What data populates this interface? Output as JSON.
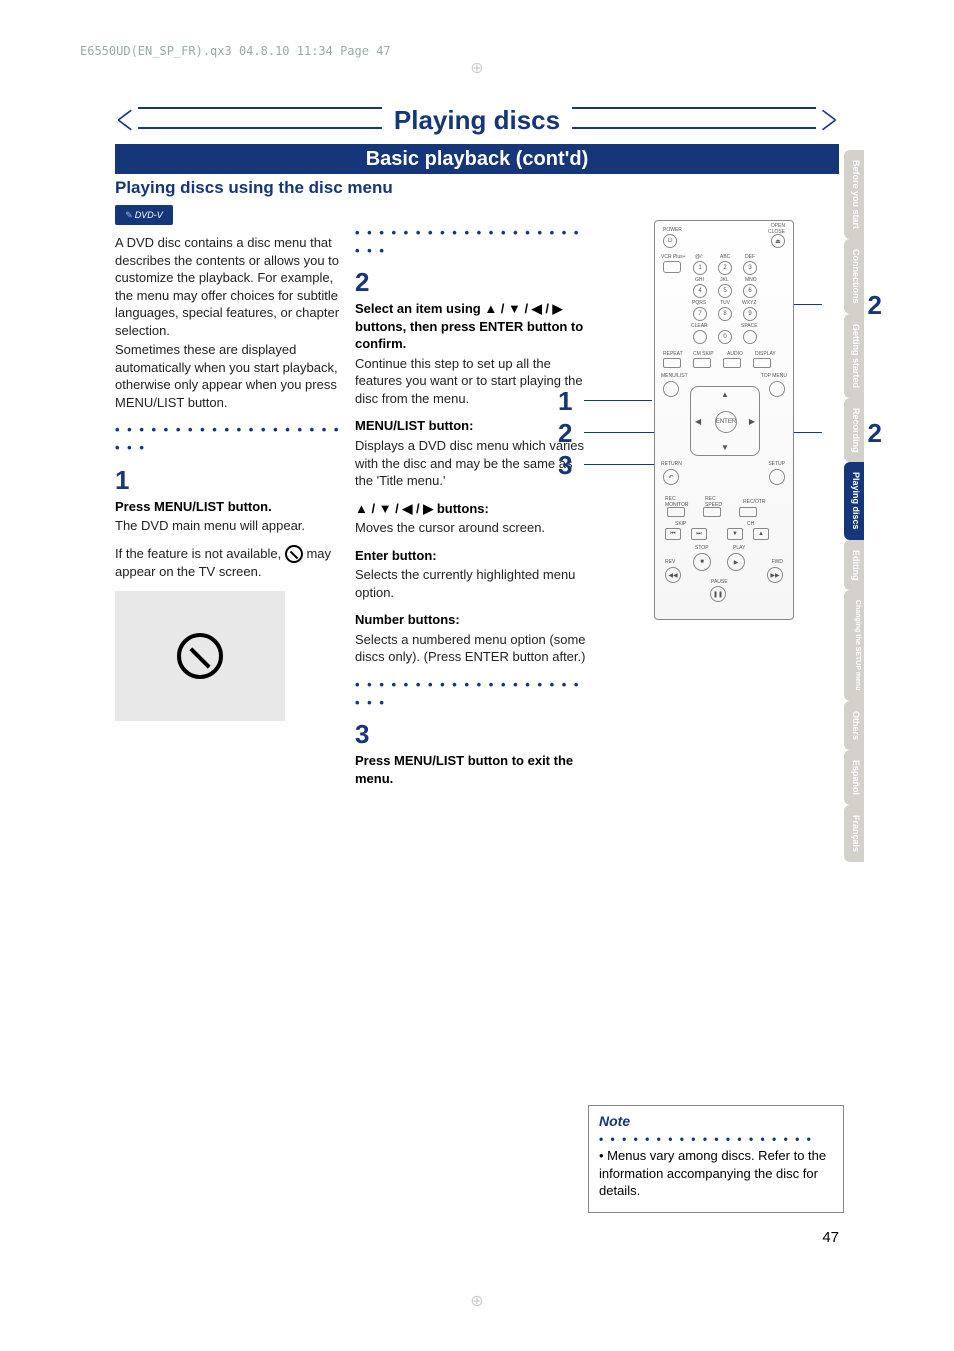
{
  "file_header": "E6550UD(EN_SP_FR).qx3  04.8.10  11:34  Page 47",
  "main_title": "Playing discs",
  "sub_title": "Basic playback (cont'd)",
  "section_heading": "Playing discs using the disc menu",
  "dvd_badge": "DVD-V",
  "col1": {
    "p1": "A DVD disc contains a disc menu that describes the contents or allows you to customize the playback. For example, the menu may offer choices for subtitle languages, special features, or chapter selection.",
    "p2": "Sometimes these are displayed automatically when you start playback, otherwise only appear when you press MENU/LIST button.",
    "step1_num": "1",
    "step1_head": "Press MENU/LIST button.",
    "step1_body": "The DVD main menu will appear.",
    "step1_note_a": "If the feature is not available,",
    "step1_note_b": "may appear on the TV screen."
  },
  "col2": {
    "step2_num": "2",
    "step2_head": "Select an item using ▲ / ▼ / ◀ / ▶ buttons, then press ENTER button to confirm.",
    "step2_body": "Continue this step to set up all the features you want or to start playing the disc from the menu.",
    "menulist_head": "MENU/LIST button:",
    "menulist_body": "Displays a DVD disc menu which varies with the disc and may be the same as the 'Title menu.'",
    "arrows_head": "▲ / ▼ / ◀ / ▶ buttons:",
    "arrows_body": "Moves the cursor around screen.",
    "enter_head": "Enter button:",
    "enter_body": "Selects the currently highlighted menu option.",
    "number_head": "Number buttons:",
    "number_body": "Selects a numbered menu option (some discs only). (Press ENTER button after.)",
    "step3_num": "3",
    "step3_head": "Press MENU/LIST button to exit the menu."
  },
  "callouts": {
    "l1": "1",
    "l2": "2",
    "l3": "3",
    "r1": "2",
    "r2": "2"
  },
  "remote_labels": {
    "power": "POWER",
    "open_close": "OPEN\nCLOSE",
    "vcr_plus": "VCR Plus+",
    "repeat": "REPEAT",
    "cm_skip": "CM SKIP",
    "audio": "AUDIO",
    "display": "DISPLAY",
    "menu_list": "MENU/LIST",
    "top_menu": "TOP MENU",
    "enter": "ENTER",
    "return": "RETURN",
    "setup": "SETUP",
    "rec_monitor": "REC\nMONITOR",
    "rec_speed": "REC\nSPEED",
    "rec_otr": "REC/OTR",
    "skip": "SKIP",
    "ch": "CH",
    "stop": "STOP",
    "play": "PLAY",
    "rev": "REV",
    "fwd": "FWD",
    "pause": "PAUSE",
    "k1": "@/:",
    "k2": "ABC",
    "k3": "DEF",
    "k4": "GHI",
    "k5": "JKL",
    "k6": "MNO",
    "k7": "PQRS",
    "k8": "TUV",
    "k9": "WXYZ",
    "clear": "CLEAR",
    "space": "SPACE"
  },
  "tabs": [
    "Before you start",
    "Connections",
    "Getting started",
    "Recording",
    "Playing discs",
    "Editing",
    "Changing the SETUP menu",
    "Others",
    "Español",
    "Français"
  ],
  "active_tab_index": 4,
  "note": {
    "title": "Note",
    "body": "Menus vary among discs. Refer to the information accompanying the disc for details."
  },
  "page_number": "47"
}
